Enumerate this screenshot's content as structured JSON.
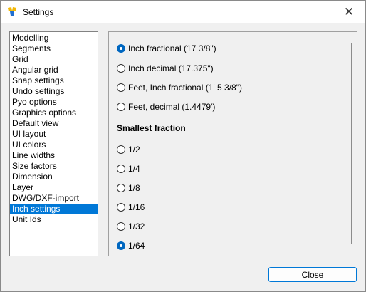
{
  "window": {
    "title": "Settings"
  },
  "nav": {
    "items": [
      {
        "label": "Modelling",
        "selected": false
      },
      {
        "label": "Segments",
        "selected": false
      },
      {
        "label": "Grid",
        "selected": false
      },
      {
        "label": "Angular grid",
        "selected": false
      },
      {
        "label": "Snap settings",
        "selected": false
      },
      {
        "label": "Undo settings",
        "selected": false
      },
      {
        "label": "Pyo options",
        "selected": false
      },
      {
        "label": "Graphics options",
        "selected": false
      },
      {
        "label": "Default view",
        "selected": false
      },
      {
        "label": "UI layout",
        "selected": false
      },
      {
        "label": "UI colors",
        "selected": false
      },
      {
        "label": "Line widths",
        "selected": false
      },
      {
        "label": "Size factors",
        "selected": false
      },
      {
        "label": "Dimension",
        "selected": false
      },
      {
        "label": "Layer",
        "selected": false
      },
      {
        "label": "DWG/DXF-import",
        "selected": false
      },
      {
        "label": "Inch settings",
        "selected": true
      },
      {
        "label": "Unit Ids",
        "selected": false
      }
    ]
  },
  "format": {
    "options": [
      {
        "label": "Inch fractional (17 3/8\")",
        "selected": true
      },
      {
        "label": "Inch decimal  (17.375\")",
        "selected": false
      },
      {
        "label": "Feet, Inch fractional  (1' 5 3/8\")",
        "selected": false
      },
      {
        "label": "Feet, decimal (1.4479')",
        "selected": false
      }
    ]
  },
  "fraction": {
    "heading": "Smallest fraction",
    "options": [
      {
        "label": "1/2",
        "selected": false
      },
      {
        "label": "1/4",
        "selected": false
      },
      {
        "label": "1/8",
        "selected": false
      },
      {
        "label": "1/16",
        "selected": false
      },
      {
        "label": "1/32",
        "selected": false
      },
      {
        "label": "1/64",
        "selected": true
      }
    ]
  },
  "footer": {
    "close_label": "Close"
  },
  "colors": {
    "accent": "#0078d7",
    "selected_radio": "#0067c0"
  }
}
